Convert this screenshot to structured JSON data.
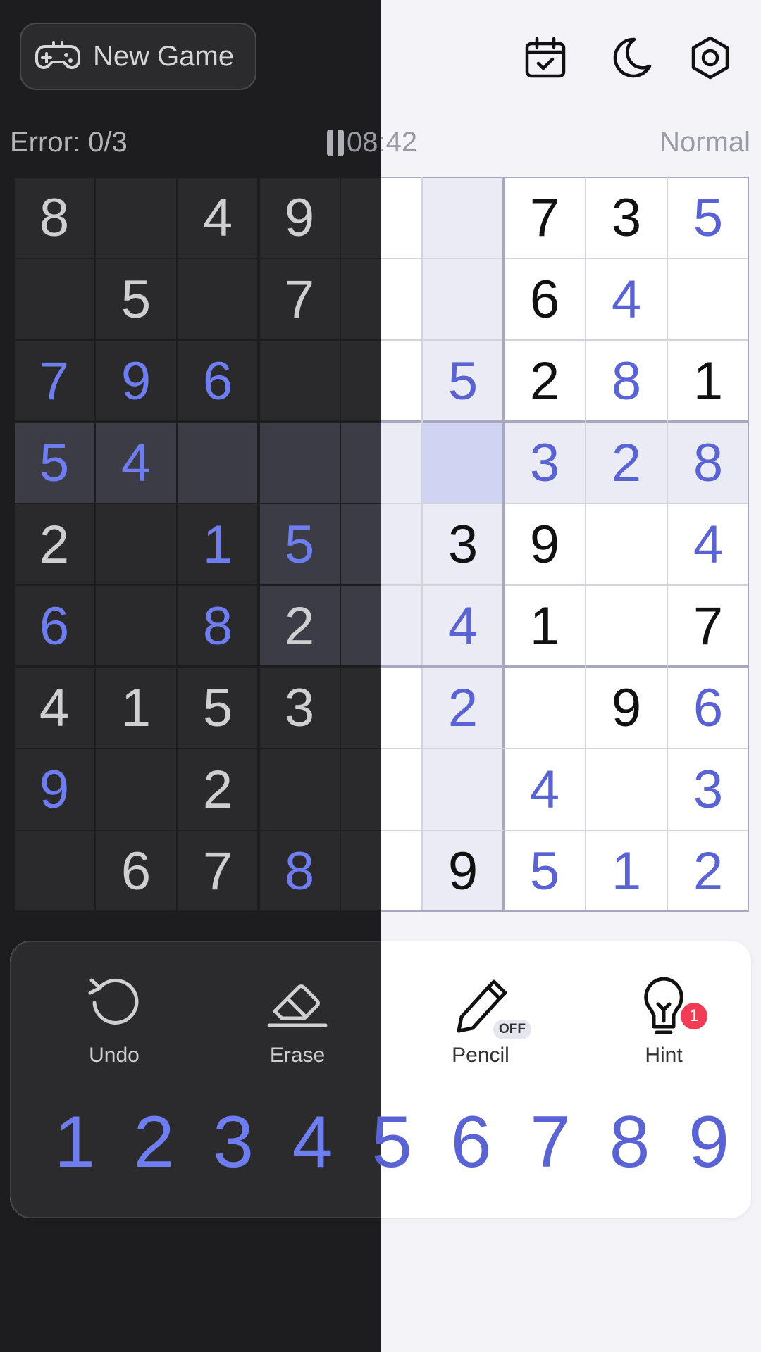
{
  "header": {
    "new_game_label": "New Game",
    "icons": [
      "daily-challenge-calendar-icon",
      "dark-mode-moon-icon",
      "settings-gear-icon"
    ]
  },
  "status": {
    "errors": "Error: 0/3",
    "timer": "08:42",
    "difficulty": "Normal"
  },
  "grid": [
    [
      "8",
      "",
      "4",
      "9",
      "",
      "",
      "7",
      "3",
      "5"
    ],
    [
      "",
      "5",
      "",
      "7",
      "",
      "",
      "6",
      "4",
      ""
    ],
    [
      "7",
      "9",
      "6",
      "",
      "",
      "5",
      "2",
      "8",
      "1"
    ],
    [
      "5",
      "4",
      "",
      "",
      "",
      "",
      "3",
      "2",
      "8"
    ],
    [
      "2",
      "",
      "1",
      "5",
      "",
      "3",
      "9",
      "",
      "4"
    ],
    [
      "6",
      "",
      "8",
      "2",
      "",
      "4",
      "1",
      "",
      "7"
    ],
    [
      "4",
      "1",
      "5",
      "3",
      "",
      "2",
      "",
      "9",
      "6"
    ],
    [
      "9",
      "",
      "2",
      "",
      "",
      "",
      "4",
      "",
      "3"
    ],
    [
      "",
      "6",
      "7",
      "8",
      "",
      "9",
      "5",
      "1",
      "2"
    ]
  ],
  "given": [
    [
      1,
      0,
      1,
      1,
      0,
      0,
      1,
      1,
      0
    ],
    [
      0,
      1,
      0,
      1,
      0,
      0,
      1,
      0,
      0
    ],
    [
      0,
      0,
      0,
      0,
      0,
      0,
      1,
      0,
      1
    ],
    [
      0,
      0,
      0,
      0,
      0,
      0,
      0,
      0,
      0
    ],
    [
      1,
      0,
      0,
      0,
      0,
      1,
      1,
      0,
      0
    ],
    [
      0,
      0,
      0,
      1,
      0,
      0,
      1,
      0,
      1
    ],
    [
      1,
      1,
      1,
      1,
      0,
      0,
      0,
      1,
      0
    ],
    [
      0,
      0,
      1,
      0,
      0,
      0,
      0,
      0,
      0
    ],
    [
      0,
      1,
      1,
      0,
      0,
      1,
      0,
      0,
      0
    ]
  ],
  "selected": {
    "row": 3,
    "col": 5
  },
  "tools": {
    "undo": "Undo",
    "erase": "Erase",
    "pencil": "Pencil",
    "pencil_state": "OFF",
    "hint": "Hint",
    "hint_count": "1"
  },
  "numbers": [
    "1",
    "2",
    "3",
    "4",
    "5",
    "6",
    "7",
    "8",
    "9"
  ],
  "colors": {
    "dark_bg": "#1d1d1f",
    "light_bg": "#f4f4f8",
    "accent_light": "#5a63d3",
    "accent_dark": "#6e7ef0",
    "selected_cell": "#d0d3f1",
    "highlight_light": "#ebebf5",
    "highlight_dark": "#3c3c46",
    "badge_red": "#f23b55"
  }
}
